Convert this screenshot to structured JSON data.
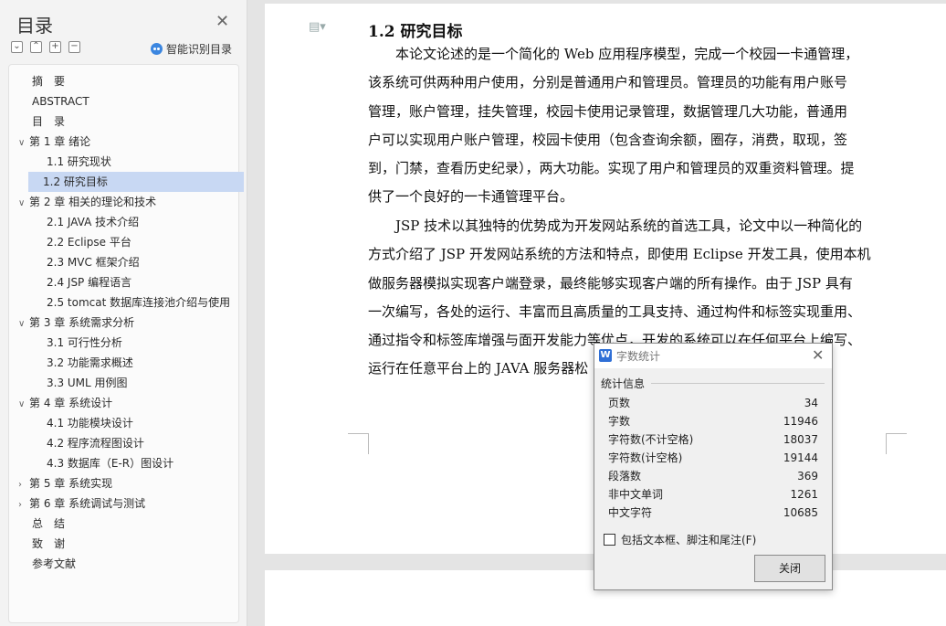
{
  "toc": {
    "title": "目录",
    "smart_label": "智能识别目录",
    "items": [
      {
        "label": "摘　要",
        "level": 0
      },
      {
        "label": "ABSTRACT",
        "level": 0
      },
      {
        "label": "目　录",
        "level": 0
      },
      {
        "label": "第 1 章  绪论",
        "level": 0,
        "expander": "expanded"
      },
      {
        "label": "1.1 研究现状",
        "level": 1
      },
      {
        "label": "1.2 研究目标",
        "level": 1,
        "active": true
      },
      {
        "label": "第 2 章  相关的理论和技术",
        "level": 0,
        "expander": "expanded"
      },
      {
        "label": "2.1 JAVA 技术介绍",
        "level": 1
      },
      {
        "label": "2.2 Eclipse 平台",
        "level": 1
      },
      {
        "label": "2.3 MVC 框架介绍",
        "level": 1
      },
      {
        "label": "2.4 JSP  编程语言",
        "level": 1
      },
      {
        "label": "2.5 tomcat  数据库连接池介绍与使用",
        "level": 1
      },
      {
        "label": "第 3 章  系统需求分析",
        "level": 0,
        "expander": "expanded"
      },
      {
        "label": "3.1  可行性分析",
        "level": 1
      },
      {
        "label": "3.2  功能需求概述",
        "level": 1
      },
      {
        "label": "3.3 UML 用例图",
        "level": 1
      },
      {
        "label": "第 4 章  系统设计",
        "level": 0,
        "expander": "expanded"
      },
      {
        "label": "4.1 功能模块设计",
        "level": 1
      },
      {
        "label": "4.2  程序流程图设计",
        "level": 1
      },
      {
        "label": "4.3  数据库（E-R）图设计",
        "level": 1
      },
      {
        "label": "第 5 章  系统实现",
        "level": 0,
        "expander": "collapsed"
      },
      {
        "label": "第 6 章  系统调试与测试",
        "level": 0,
        "expander": "collapsed"
      },
      {
        "label": "总　结",
        "level": 0
      },
      {
        "label": "致　谢",
        "level": 0
      },
      {
        "label": "参考文献",
        "level": 0
      }
    ]
  },
  "document": {
    "heading": "1.2 研究目标",
    "paragraph1": [
      "　　本论文论述的是一个简化的 Web 应用程序模型，完成一个校园一卡通管理，",
      "该系统可供两种用户使用，分别是普通用户和管理员。管理员的功能有用户账号",
      "管理，账户管理，挂失管理，校园卡使用记录管理，数据管理几大功能，普通用",
      "户可以实现用户账户管理，校园卡使用（包含查询余额，圈存，消费，取现，签",
      "到，门禁，查看历史纪录），两大功能。实现了用户和管理员的双重资料管理。提",
      "供了一个良好的一卡通管理平台。"
    ],
    "paragraph2": [
      "　　JSP 技术以其独特的优势成为开发网站系统的首选工具，论文中以一种简化的",
      "方式介绍了 JSP 开发网站系统的方法和特点，即使用 Eclipse 开发工具，使用本机",
      "做服务器模拟实现客户端登录，最终能够实现客户端的所有操作。由于 JSP 具有",
      "一次编写，各处的运行、丰富而且高质量的工具支持、通过构件和标签实现重用、",
      "通过指令和标签库增强与面开发能力等优点，开发的系统可以在任何平台上编写、",
      "运行在任意平台上的 JAVA 服务器松"
    ]
  },
  "dialog": {
    "title": "字数统计",
    "group_label": "统计信息",
    "stats": [
      {
        "label": "页数",
        "value": "34"
      },
      {
        "label": "字数",
        "value": "11946"
      },
      {
        "label": "字符数(不计空格)",
        "value": "18037"
      },
      {
        "label": "字符数(计空格)",
        "value": "19144"
      },
      {
        "label": "段落数",
        "value": "369"
      },
      {
        "label": "非中文单词",
        "value": "1261"
      },
      {
        "label": "中文字符",
        "value": "10685"
      }
    ],
    "checkbox_label": "包括文本框、脚注和尾注(F)",
    "checkbox_checked": false,
    "close_button": "关闭"
  },
  "colors": {
    "toc_active": "#c8d8f3",
    "accent": "#2f6fd6"
  }
}
